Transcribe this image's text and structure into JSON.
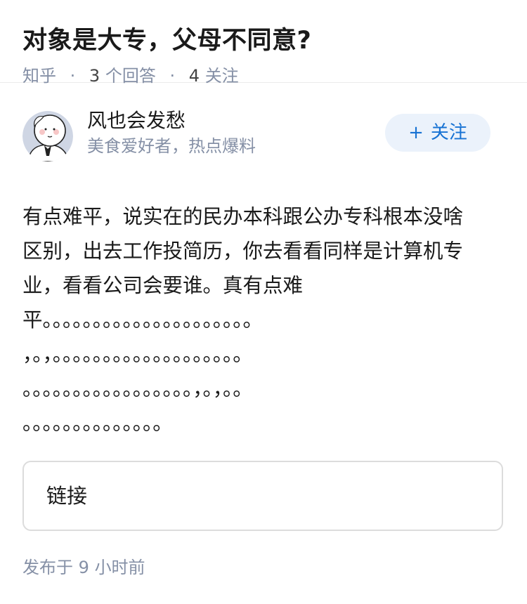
{
  "question": {
    "title": "对象是大专，父母不同意?",
    "source": "知乎",
    "answer_count": "3",
    "answer_unit": "个回答",
    "follower_count": "4",
    "follower_unit": "关注",
    "separator": "·"
  },
  "author": {
    "name": "风也会发愁",
    "bio": "美食爱好者，热点爆料",
    "follow_plus": "+",
    "follow_label": "关注",
    "avatar_icon": "cartoon-face-avatar-icon"
  },
  "answer": {
    "lines": [
      "有点难平，说实在的民办本科跟公办专科根本没啥",
      "区别，出去工作投简历，你去看看同样是计算机专",
      "业，看看公司会要谁。真有点难",
      "平。。。。。。。。。。。。。。。。。。。。。",
      "，。，。。。。。。。。。。。。。。。。。。。",
      "。。。。。。。。。。。。。。。。。，。，。。",
      "。。。。。。。。。。。。。。"
    ],
    "link_label": "链接"
  },
  "footer": {
    "publish_prefix": "发布于",
    "time_value": "9",
    "time_unit": "小时前"
  },
  "colors": {
    "meta_gray": "#8590a6",
    "follow_blue": "#1772d3",
    "follow_bg": "#ebf2fb"
  }
}
